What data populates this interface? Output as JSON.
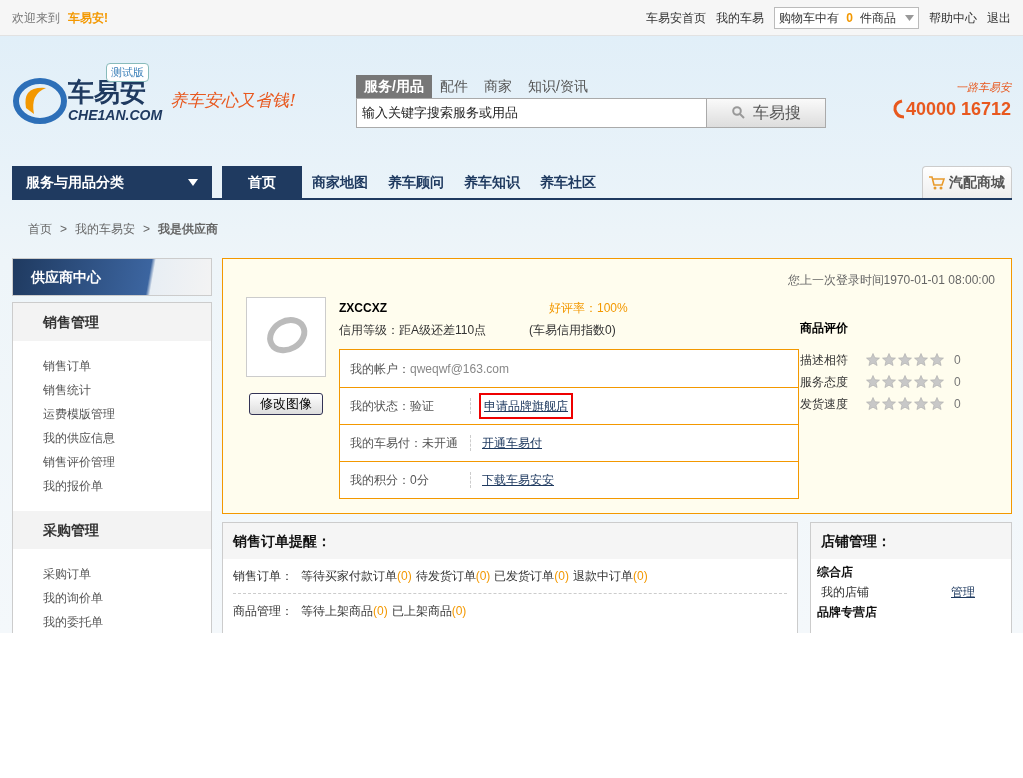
{
  "top_bar": {
    "welcome": "欢迎来到",
    "brand": "车易安!",
    "links": [
      "车易安首页",
      "我的车易"
    ],
    "cart": {
      "prefix": "购物车中有",
      "count": "0",
      "suffix": "件商品"
    },
    "links_after": [
      "帮助中心",
      "退出"
    ]
  },
  "logo": {
    "name": "车易安",
    "domain": "CHE1AN.COM",
    "badge": "测试版",
    "slogan": "养车安心又省钱!"
  },
  "search": {
    "tabs": [
      {
        "label": "服务/用品",
        "selected": true
      },
      {
        "label": "配件",
        "selected": false
      },
      {
        "label": "商家",
        "selected": false
      },
      {
        "label": "知识/资讯",
        "selected": false
      }
    ],
    "value": "输入关键字搜索服务或用品",
    "button": "车易搜"
  },
  "hotline": {
    "tagline": "一路车易安",
    "number": "40000 16712"
  },
  "nav": {
    "category": "服务与用品分类",
    "items": [
      {
        "label": "首页",
        "selected": true
      },
      {
        "label": "商家地图",
        "selected": false
      },
      {
        "label": "养车顾问",
        "selected": false
      },
      {
        "label": "养车知识",
        "selected": false
      },
      {
        "label": "养车社区",
        "selected": false
      }
    ],
    "mall": "汽配商城"
  },
  "breadcrumb": [
    {
      "label": "首页",
      "current": false
    },
    {
      "label": "我的车易安",
      "current": false
    },
    {
      "label": "我是供应商",
      "current": true
    }
  ],
  "breadcrumb_separator": ">",
  "sidebar": {
    "title": "供应商中心",
    "groups": [
      {
        "title": "销售管理",
        "items": [
          "销售订单",
          "销售统计",
          "运费模版管理",
          "我的供应信息",
          "销售评价管理",
          "我的报价单"
        ]
      },
      {
        "title": "采购管理",
        "items": [
          "采购订单",
          "我的询价单",
          "我的委托单"
        ]
      }
    ]
  },
  "profile": {
    "last_login": "您上一次登录时间1970-01-01 08:00:00",
    "name": "ZXCCXZ",
    "rating": "好评率：100%",
    "credit": "信用等级：距A级还差110点",
    "credit_index": "(车易信用指数0)",
    "avatar_button": "修改图像",
    "info_rows": [
      {
        "label": "我的帐户：",
        "value": "qweqwf@163.com"
      },
      {
        "label": "我的状态：验证",
        "link": "申请品牌旗舰店",
        "highlighted": true
      },
      {
        "label": "我的车易付：未开通",
        "link": "开通车易付",
        "highlighted": false
      },
      {
        "label": "我的积分：0分",
        "link": "下载车易安安",
        "highlighted": false
      }
    ]
  },
  "reviews": {
    "title": "商品评价",
    "items": [
      {
        "label": "描述相符",
        "stars": 0,
        "score": "0"
      },
      {
        "label": "服务态度",
        "stars": 0,
        "score": "0"
      },
      {
        "label": "发货速度",
        "stars": 0,
        "score": "0"
      }
    ]
  },
  "sales_reminder": {
    "title": "销售订单提醒：",
    "lines": [
      {
        "label": "销售订单：",
        "entries": [
          {
            "text": "等待买家付款订单",
            "count": "(0)"
          },
          {
            "text": "待发货订单",
            "count": "(0)"
          },
          {
            "text": "已发货订单",
            "count": "(0)"
          },
          {
            "text": "退款中订单",
            "count": "(0)"
          }
        ]
      },
      {
        "label": "商品管理：",
        "entries": [
          {
            "text": "等待上架商品",
            "count": "(0)"
          },
          {
            "text": "已上架商品",
            "count": "(0)"
          }
        ]
      }
    ]
  },
  "store": {
    "title": "店铺管理：",
    "sections": [
      {
        "title": "综合店",
        "items": [
          {
            "label": "我的店铺",
            "action": "管理"
          }
        ]
      },
      {
        "title": "品牌专营店"
      }
    ]
  }
}
